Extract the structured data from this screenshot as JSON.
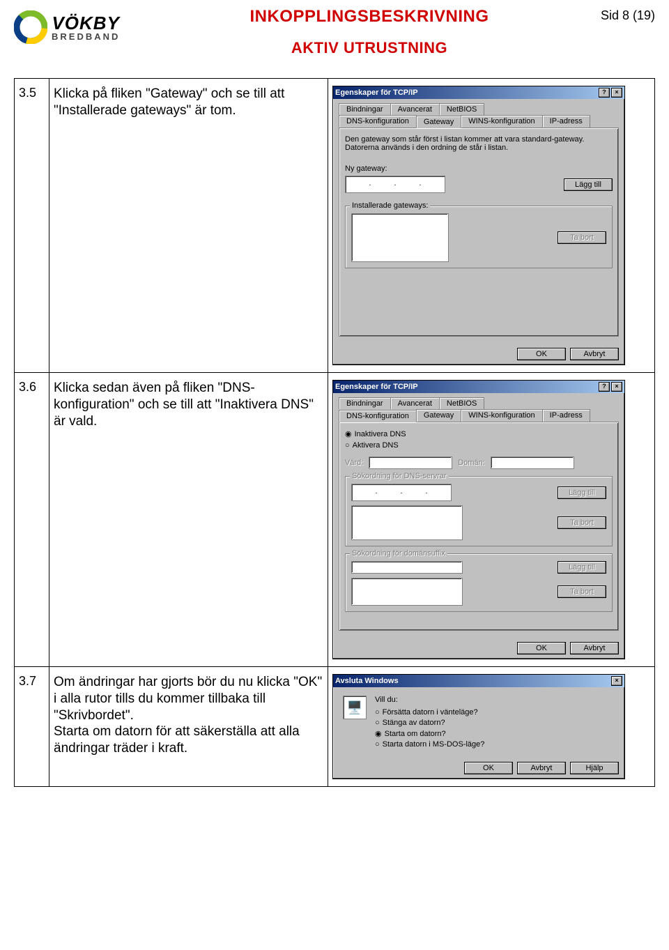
{
  "header": {
    "logo_main": "VÖKBY",
    "logo_sub": "BREDBAND",
    "doc_title": "INKOPPLINGSBESKRIVNING",
    "doc_subtitle": "AKTIV UTRUSTNING",
    "page_indicator": "Sid 8 (19)"
  },
  "steps": [
    {
      "num": "3.5",
      "text": "Klicka på fliken \"Gateway\" och se till att \"Installerade gateways\" är tom."
    },
    {
      "num": "3.6",
      "text": "Klicka sedan även på fliken \"DNS-konfiguration\" och se till att \"Inaktivera DNS\" är vald."
    },
    {
      "num": "3.7",
      "text": "Om ändringar har gjorts bör du nu klicka \"OK\" i alla rutor tills du kommer tillbaka till \"Skrivbordet\".\nStarta om datorn för att säkerställa att alla ändringar träder i kraft."
    }
  ],
  "dlg_tcpip": {
    "title": "Egenskaper för TCP/IP",
    "tabs_row1": [
      "Bindningar",
      "Avancerat",
      "NetBIOS"
    ],
    "tabs_row2": [
      "DNS-konfiguration",
      "Gateway",
      "WINS-konfiguration",
      "IP-adress"
    ],
    "gateway_desc": "Den gateway som står först i listan kommer att vara standard-gateway. Datorerna används i den ordning de står i listan.",
    "new_gateway_label": "Ny gateway:",
    "add_btn": "Lägg till",
    "installed_label": "Installerade gateways:",
    "remove_btn": "Ta bort",
    "ok": "OK",
    "cancel": "Avbryt",
    "dns_disable": "Inaktivera DNS",
    "dns_enable": "Aktivera DNS",
    "host_label": "Värd:",
    "domain_label": "Domän:",
    "dns_search_label": "Sökordning för DNS-servrar",
    "suffix_label": "Sökordning för domänsuffix"
  },
  "dlg_shutdown": {
    "title": "Avsluta Windows",
    "prompt": "Vill du:",
    "opts": [
      "Försätta datorn i vänteläge?",
      "Stänga av datorn?",
      "Starta om datorn?",
      "Starta datorn i MS-DOS-läge?"
    ],
    "ok": "OK",
    "cancel": "Avbryt",
    "help": "Hjälp"
  }
}
